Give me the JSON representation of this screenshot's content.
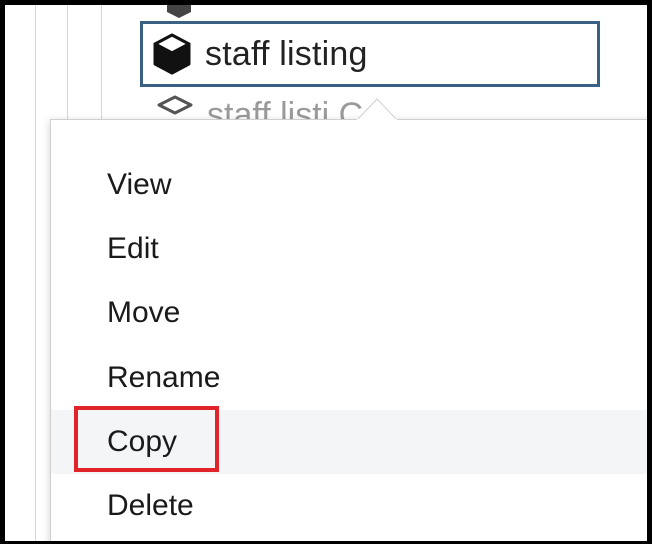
{
  "tree": {
    "selected_node": {
      "label": "staff listing",
      "icon": "cube-icon"
    },
    "faded_node": {
      "label": "staff listi     C",
      "icon": "cube-outline-icon"
    }
  },
  "context_menu": {
    "items": [
      {
        "label": "View"
      },
      {
        "label": "Edit"
      },
      {
        "label": "Move"
      },
      {
        "label": "Rename"
      },
      {
        "label": "Copy",
        "highlighted": true
      },
      {
        "label": "Delete"
      }
    ]
  },
  "colors": {
    "selection_border": "#3a6086",
    "highlight_border": "#e0242a",
    "hover_row": "#f4f5f7"
  }
}
